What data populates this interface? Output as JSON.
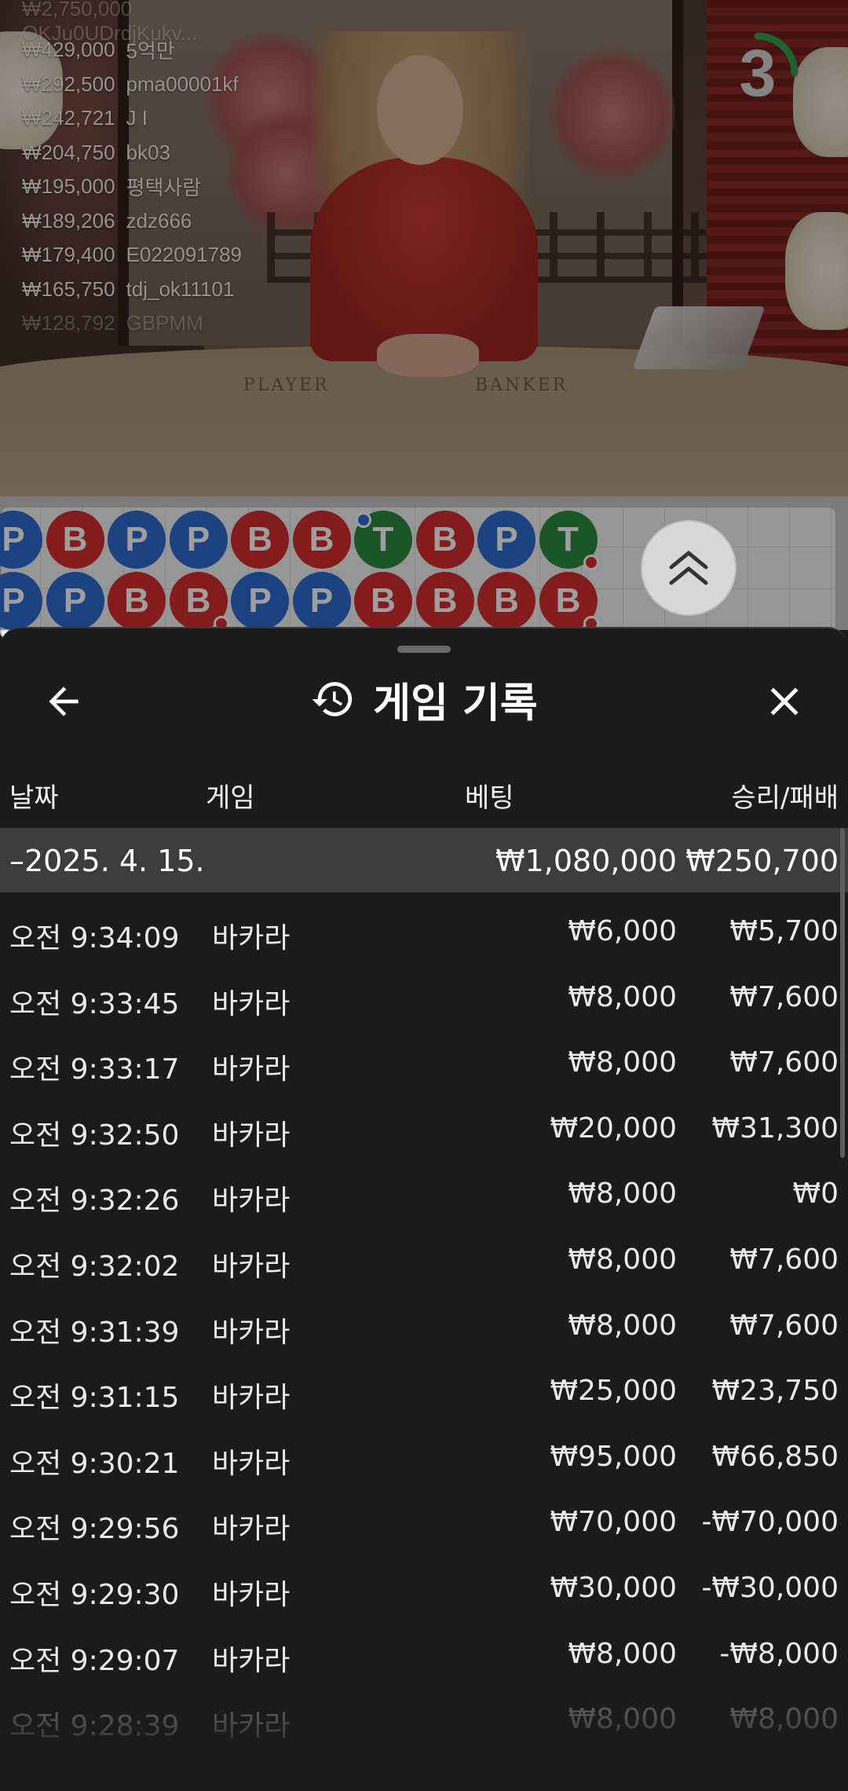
{
  "video": {
    "countdown": "3",
    "table_labels": [
      "PLAYER",
      "BANKER"
    ],
    "leaderboard_top_partial": "₩2,750,000  OKJu0UDrdjKukv...",
    "leaderboard": [
      {
        "amount": "₩429,000",
        "name": "5억만"
      },
      {
        "amount": "₩292,500",
        "name": "pma00001kf"
      },
      {
        "amount": "₩242,721",
        "name": "J I"
      },
      {
        "amount": "₩204,750",
        "name": "bk03"
      },
      {
        "amount": "₩195,000",
        "name": "평택사람"
      },
      {
        "amount": "₩189,206",
        "name": "zdz666"
      },
      {
        "amount": "₩179,400",
        "name": "E022091789"
      },
      {
        "amount": "₩165,750",
        "name": "tdj_ok11101"
      },
      {
        "amount": "₩128,792",
        "name": "GBPMM"
      }
    ]
  },
  "roadmap": {
    "row1": [
      "P",
      "B",
      "P",
      "P",
      "B",
      "B",
      "T",
      "B",
      "P",
      "T"
    ],
    "row2": [
      "P",
      "P",
      "B",
      "B",
      "P",
      "P",
      "B",
      "B",
      "B",
      "B"
    ],
    "colors": {
      "player": "#2f6bd1",
      "banker": "#d32f2f",
      "tie": "#2e8b3e"
    }
  },
  "sheet": {
    "title": "게임 기록",
    "icons": {
      "back": "arrow-left-icon",
      "history": "history-icon",
      "close": "close-icon"
    },
    "columns": {
      "date": "날짜",
      "game": "게임",
      "bet": "베팅",
      "winloss": "승리/패배"
    },
    "summary": {
      "date": "–2025. 4. 15.",
      "bet": "₩1,080,000",
      "winloss": "₩250,700"
    },
    "rows": [
      {
        "time": "오전 9:34:09",
        "game": "바카라",
        "bet": "₩6,000",
        "winloss": "₩5,700"
      },
      {
        "time": "오전 9:33:45",
        "game": "바카라",
        "bet": "₩8,000",
        "winloss": "₩7,600"
      },
      {
        "time": "오전 9:33:17",
        "game": "바카라",
        "bet": "₩8,000",
        "winloss": "₩7,600"
      },
      {
        "time": "오전 9:32:50",
        "game": "바카라",
        "bet": "₩20,000",
        "winloss": "₩31,300"
      },
      {
        "time": "오전 9:32:26",
        "game": "바카라",
        "bet": "₩8,000",
        "winloss": "₩0"
      },
      {
        "time": "오전 9:32:02",
        "game": "바카라",
        "bet": "₩8,000",
        "winloss": "₩7,600"
      },
      {
        "time": "오전 9:31:39",
        "game": "바카라",
        "bet": "₩8,000",
        "winloss": "₩7,600"
      },
      {
        "time": "오전 9:31:15",
        "game": "바카라",
        "bet": "₩25,000",
        "winloss": "₩23,750"
      },
      {
        "time": "오전 9:30:21",
        "game": "바카라",
        "bet": "₩95,000",
        "winloss": "₩66,850"
      },
      {
        "time": "오전 9:29:56",
        "game": "바카라",
        "bet": "₩70,000",
        "winloss": "-₩70,000"
      },
      {
        "time": "오전 9:29:30",
        "game": "바카라",
        "bet": "₩30,000",
        "winloss": "-₩30,000"
      },
      {
        "time": "오전 9:29:07",
        "game": "바카라",
        "bet": "₩8,000",
        "winloss": "-₩8,000"
      },
      {
        "time": "오전 9:28:39",
        "game": "바카라",
        "bet": "₩8,000",
        "winloss": "₩8,000"
      }
    ]
  }
}
